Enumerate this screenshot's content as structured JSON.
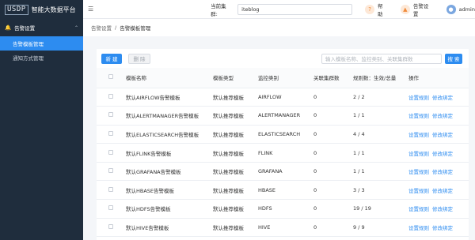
{
  "app": {
    "logo_mark": "USDP",
    "title": "智能大数据平台"
  },
  "sidebar": {
    "group_label": "告警设置",
    "items": [
      {
        "label": "告警模板管理",
        "active": true
      },
      {
        "label": "通知方式管理",
        "active": false
      }
    ]
  },
  "topbar": {
    "cluster_label": "当前集群:",
    "cluster_value": "iteblog",
    "help_label": "帮助",
    "alert_settings_label": "告警设置",
    "user_label": "admin"
  },
  "breadcrumb": {
    "root": "告警设置",
    "separator": "/",
    "current": "告警模板管理"
  },
  "toolbar": {
    "new_label": "新 建",
    "delete_label": "删 除",
    "search_placeholder": "输入模板名称、监控类别、关联集群数",
    "search_label": "搜 索"
  },
  "table": {
    "headers": [
      "模板名称",
      "模板类型",
      "监控类别",
      "关联集群数",
      "规则数：生效/总量",
      "操作"
    ],
    "action_labels": {
      "rules": "设置规则",
      "bind": "修改绑定"
    },
    "rows": [
      {
        "name": "默认AIRFLOW告警模板",
        "type": "默认推荐模板",
        "category": "AIRFLOW",
        "clusters": "0",
        "rules": "2 / 2"
      },
      {
        "name": "默认ALERTMANAGER告警模板",
        "type": "默认推荐模板",
        "category": "ALERTMANAGER",
        "clusters": "0",
        "rules": "1 / 1"
      },
      {
        "name": "默认ELASTICSEARCH告警模板",
        "type": "默认推荐模板",
        "category": "ELASTICSEARCH",
        "clusters": "0",
        "rules": "4 / 4"
      },
      {
        "name": "默认FLINK告警模板",
        "type": "默认推荐模板",
        "category": "FLINK",
        "clusters": "0",
        "rules": "1 / 1"
      },
      {
        "name": "默认GRAFANA告警模板",
        "type": "默认推荐模板",
        "category": "GRAFANA",
        "clusters": "0",
        "rules": "1 / 1"
      },
      {
        "name": "默认HBASE告警模板",
        "type": "默认推荐模板",
        "category": "HBASE",
        "clusters": "0",
        "rules": "3 / 3"
      },
      {
        "name": "默认HDFS告警模板",
        "type": "默认推荐模板",
        "category": "HDFS",
        "clusters": "0",
        "rules": "19 / 19"
      },
      {
        "name": "默认HIVE告警模板",
        "type": "默认推荐模板",
        "category": "HIVE",
        "clusters": "0",
        "rules": "9 / 9"
      }
    ]
  },
  "colors": {
    "primary": "#2d8cf0",
    "sidebar_bg": "#1f2d3d"
  },
  "icons": {
    "menu": "hamburger-icon",
    "help": "help-icon",
    "alert": "bell-icon",
    "user": "user-avatar-icon"
  }
}
